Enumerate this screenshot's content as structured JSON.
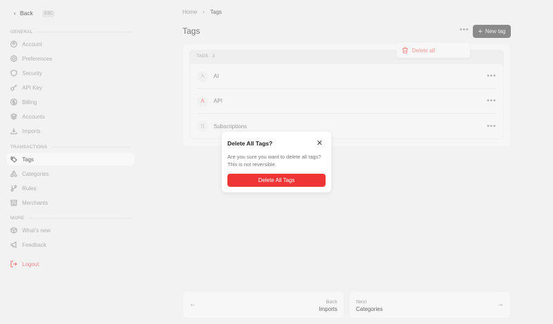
{
  "sidebar": {
    "back": "Back",
    "esc": "ESC",
    "sections": [
      "GENERAL",
      "TRANSACTIONS",
      "MORE"
    ],
    "general": [
      "Account",
      "Preferences",
      "Security",
      "API Key",
      "Billing",
      "Accounts",
      "Imports"
    ],
    "transactions": [
      "Tags",
      "Categories",
      "Rules",
      "Merchants"
    ],
    "more": [
      "What's new",
      "Feedback"
    ],
    "logout": "Logout"
  },
  "breadcrumb": {
    "home": "Home",
    "current": "Tags"
  },
  "header": {
    "title": "Tags",
    "more": "•••",
    "new_tag": "New tag"
  },
  "dropdown": {
    "delete_all": "Delete all"
  },
  "tags": {
    "heading": "TAGS · 3",
    "items": [
      {
        "initial": "A",
        "name": "AI",
        "color": "#cccccc"
      },
      {
        "initial": "A",
        "name": "API",
        "color": "#f08a8a"
      },
      {
        "initial": "S",
        "name": "Subscriptions",
        "color": "#cccccc"
      }
    ],
    "row_menu": "•••"
  },
  "modal": {
    "title": "Delete All Tags?",
    "body": "Are you sure you want to delete all tags? This is not reversible.",
    "confirm": "Delete All Tags",
    "close": "✕"
  },
  "footer": {
    "back_label": "Back",
    "back_page": "Imports",
    "next_label": "Next",
    "next_page": "Categories"
  }
}
